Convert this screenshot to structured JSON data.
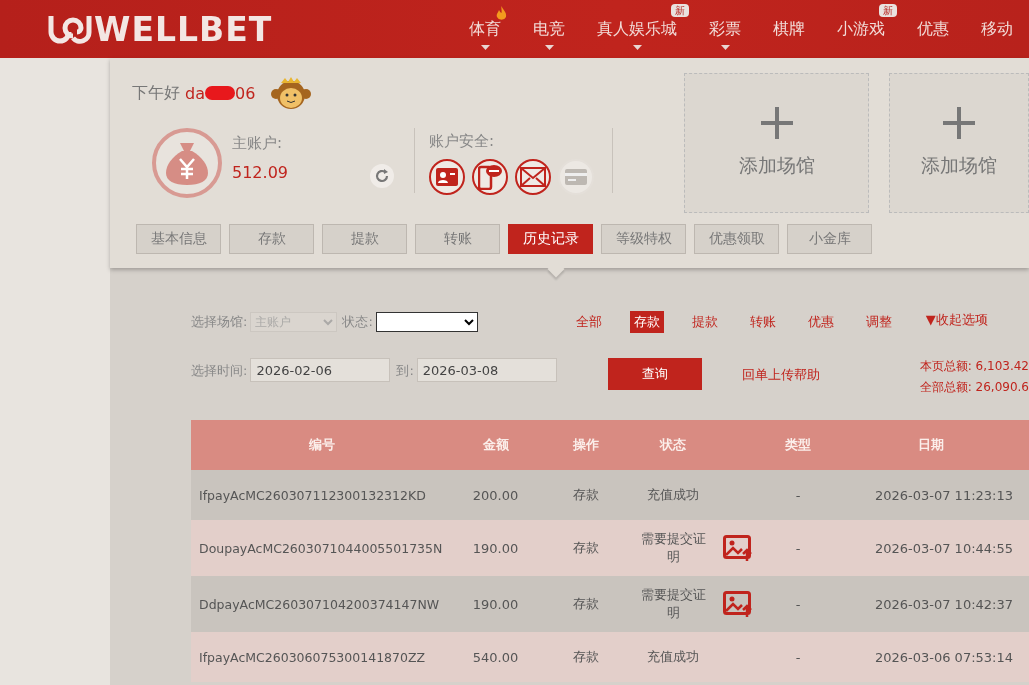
{
  "header": {
    "logo": "WELLBET",
    "nav": [
      {
        "label": "体育",
        "hot": true,
        "dropdown": true
      },
      {
        "label": "电竞",
        "hot": false,
        "dropdown": true
      },
      {
        "label": "真人娱乐城",
        "hot": false,
        "dropdown": true,
        "badge": "新"
      },
      {
        "label": "彩票",
        "hot": false,
        "dropdown": true
      },
      {
        "label": "棋牌",
        "hot": false,
        "dropdown": false
      },
      {
        "label": "小游戏",
        "hot": false,
        "dropdown": false,
        "badge": "新"
      },
      {
        "label": "优惠",
        "hot": false,
        "dropdown": false
      },
      {
        "label": "移动",
        "hot": false,
        "dropdown": false
      }
    ]
  },
  "account": {
    "greeting": "下午好",
    "username_start": "da",
    "username_end": "06",
    "main_account_label": "主账户:",
    "balance": "512.09",
    "security_label": "账户安全:",
    "security_items": [
      {
        "kind": "id-card",
        "verified": true
      },
      {
        "kind": "sms",
        "verified": true
      },
      {
        "kind": "email",
        "verified": true
      },
      {
        "kind": "bank-card",
        "verified": false
      }
    ],
    "venues": [
      {
        "label": "添加场馆"
      },
      {
        "label": "添加场馆"
      }
    ],
    "tabs": [
      {
        "label": "基本信息",
        "selected": false
      },
      {
        "label": "存款",
        "selected": false
      },
      {
        "label": "提款",
        "selected": false
      },
      {
        "label": "转账",
        "selected": false
      },
      {
        "label": "历史记录",
        "selected": true
      },
      {
        "label": "等级特权",
        "selected": false
      },
      {
        "label": "优惠领取",
        "selected": false
      },
      {
        "label": "小金库",
        "selected": false
      }
    ]
  },
  "filters": {
    "venue_label": "选择场馆:",
    "venue_select": {
      "value": "主账户",
      "disabled": true
    },
    "status_label": "状态:",
    "type_filters": [
      {
        "label": "全部",
        "selected": false
      },
      {
        "label": "存款",
        "selected": true
      },
      {
        "label": "提款",
        "selected": false
      },
      {
        "label": "转账",
        "selected": false
      },
      {
        "label": "优惠",
        "selected": false
      },
      {
        "label": "调整",
        "selected": false
      }
    ],
    "collapse_link": "▼收起选项",
    "time_label": "选择时间:",
    "start_date": "2026-02-06",
    "to_label": "到:",
    "end_date": "2026-03-08",
    "query_button": "查询",
    "help_link": "回单上传帮助",
    "page_total": "本页总额: 6,103.42",
    "all_total": "全部总额: 26,090.6"
  },
  "table": {
    "columns": [
      "编号",
      "金额",
      "操作",
      "状态",
      "类型",
      "日期"
    ],
    "rows": [
      {
        "id": "IfpayAcMC26030711230013231​2KD",
        "amount": "200.00",
        "operation": "存款",
        "status": "充值成功",
        "proof_required": false,
        "type": "-",
        "date": "2026-03-07 11:23:13"
      },
      {
        "id": "DoupayAcMC2603071044005501735N",
        "amount": "190.00",
        "operation": "存款",
        "status": "需要提交证明",
        "proof_required": true,
        "type": "-",
        "date": "2026-03-07 10:44:55"
      },
      {
        "id": "DdpayAcMC260307104200374147NW",
        "amount": "190.00",
        "operation": "存款",
        "status": "需要提交证明",
        "proof_required": true,
        "type": "-",
        "date": "2026-03-07 10:42:37"
      },
      {
        "id": "IfpayAcMC260306075300141870ZZ",
        "amount": "540.00",
        "operation": "存款",
        "status": "充值成功",
        "proof_required": false,
        "type": "-",
        "date": "2026-03-06 07:53:14"
      }
    ]
  }
}
